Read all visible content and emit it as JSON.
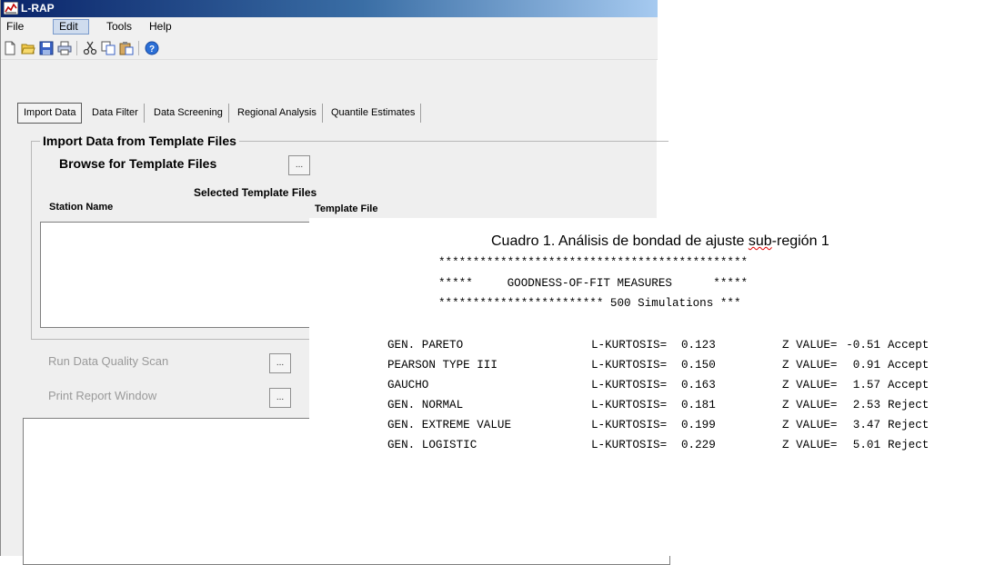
{
  "window": {
    "title": "L-RAP"
  },
  "menubar": {
    "items": [
      "File",
      "Edit",
      "Tools",
      "Help"
    ],
    "active": "Edit"
  },
  "toolbar": {
    "icons": [
      "new-file-icon",
      "open-folder-icon",
      "save-icon",
      "print-icon",
      "cut-icon",
      "copy-icon",
      "paste-icon",
      "help-icon"
    ]
  },
  "tabs": [
    "Import Data",
    "Data Filter",
    "Data Screening",
    "Regional Analysis",
    "Quantile Estimates"
  ],
  "import": {
    "group_title": "Import Data from Template Files",
    "browse_label": "Browse for Template Files",
    "browse_button": "...",
    "selected_files_label": "Selected Template Files",
    "col_station": "Station Name",
    "col_template": "Template File",
    "run_scan_label": "Run Data Quality Scan",
    "run_scan_button": "...",
    "print_report_label": "Print Report Window",
    "print_report_button": "..."
  },
  "report": {
    "caption_prefix": "Cuadro 1. Análisis de bondad de ajuste ",
    "caption_misspelled": "sub",
    "caption_suffix": "-región 1",
    "banner_line1": "*********************************************",
    "banner_line2": "*****     GOODNESS-OF-FIT MEASURES      *****",
    "banner_line3": "************************ 500 Simulations ***",
    "rows": [
      {
        "dist": "GEN. PARETO",
        "kurt_label": "L-KURTOSIS=",
        "kurt": "0.123",
        "z_label": "Z VALUE=",
        "z": "-0.51",
        "result": "Accept"
      },
      {
        "dist": "PEARSON TYPE III",
        "kurt_label": "L-KURTOSIS=",
        "kurt": "0.150",
        "z_label": "Z VALUE=",
        "z": "0.91",
        "result": "Accept"
      },
      {
        "dist": "GAUCHO",
        "kurt_label": "L-KURTOSIS=",
        "kurt": "0.163",
        "z_label": "Z VALUE=",
        "z": "1.57",
        "result": "Accept"
      },
      {
        "dist": "GEN. NORMAL",
        "kurt_label": "L-KURTOSIS=",
        "kurt": "0.181",
        "z_label": "Z VALUE=",
        "z": "2.53",
        "result": "Reject"
      },
      {
        "dist": "GEN. EXTREME VALUE",
        "kurt_label": "L-KURTOSIS=",
        "kurt": "0.199",
        "z_label": "Z VALUE=",
        "z": "3.47",
        "result": "Reject"
      },
      {
        "dist": "GEN. LOGISTIC",
        "kurt_label": "L-KURTOSIS=",
        "kurt": "0.229",
        "z_label": "Z VALUE=",
        "z": "5.01",
        "result": "Reject"
      }
    ]
  }
}
